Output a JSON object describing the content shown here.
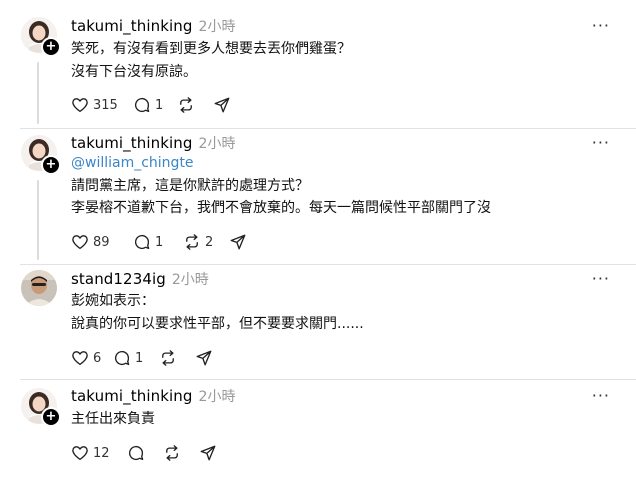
{
  "posts": [
    {
      "username": "takumi_thinking",
      "time": "2小時",
      "mention": "",
      "lines": [
        "笑死，有沒有看到更多人想要去丟你們雞蛋？",
        "沒有下台沒有原諒。"
      ],
      "likes": "315",
      "replies": "1",
      "reposts": "",
      "has_follow_badge": true
    },
    {
      "username": "takumi_thinking",
      "time": "2小時",
      "mention": "@william_chingte",
      "lines": [
        "請問黨主席，這是你默許的處理方式？",
        "李晏榕不道歉下台，我們不會放棄的。每天一篇問候性平部關門了沒"
      ],
      "likes": "89",
      "replies": "1",
      "reposts": "2",
      "has_follow_badge": true
    },
    {
      "username": "stand1234ig",
      "time": "2小時",
      "mention": "",
      "lines": [
        "彭婉如表示：",
        "說真的你可以要求性平部，但不要要求關門......"
      ],
      "likes": "6",
      "replies": "1",
      "reposts": "",
      "has_follow_badge": false
    },
    {
      "username": "takumi_thinking",
      "time": "2小時",
      "mention": "",
      "lines": [
        "主任出來負責"
      ],
      "likes": "12",
      "replies": "",
      "reposts": "",
      "has_follow_badge": true
    }
  ],
  "icons": {
    "more": "more-icon",
    "like": "heart-icon",
    "reply": "comment-icon",
    "repost": "repost-icon",
    "share": "send-icon"
  },
  "colors": {
    "mention": "#3a86c8",
    "time": "#999999",
    "divider": "#e2e2e2"
  }
}
